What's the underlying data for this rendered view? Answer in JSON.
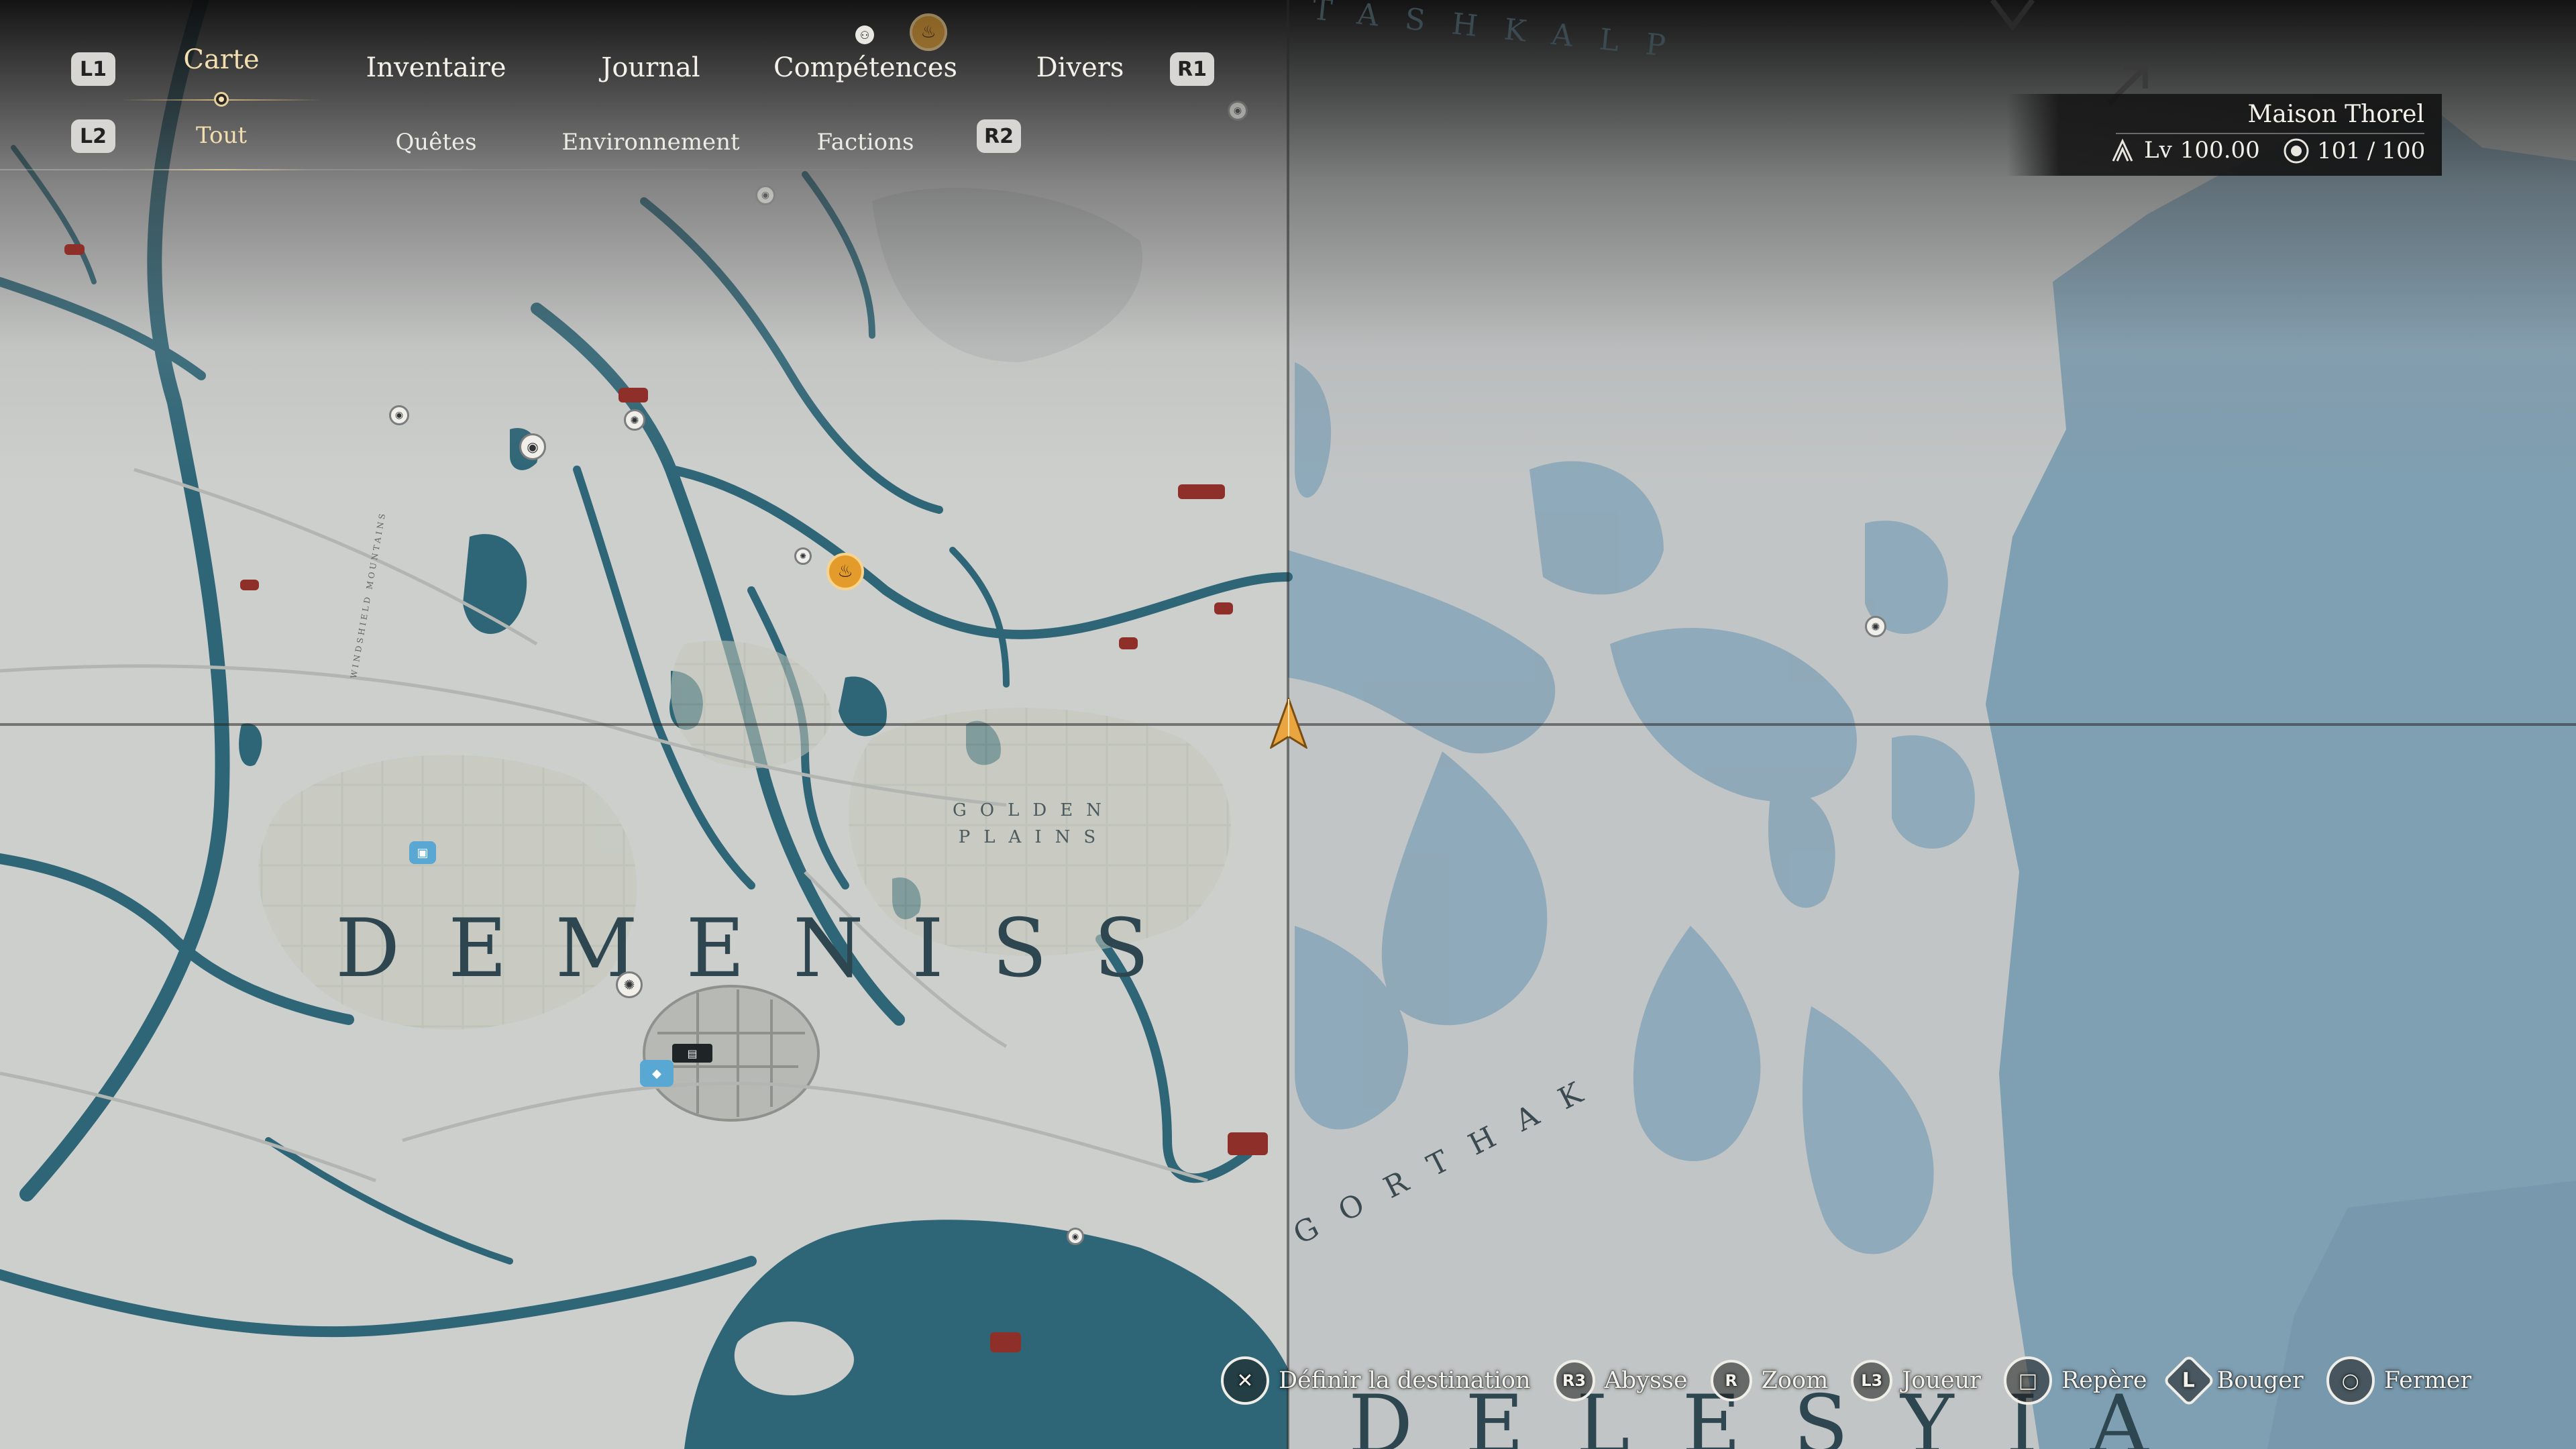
{
  "nav": {
    "row1": [
      {
        "key": "l1",
        "label": "L1"
      },
      {
        "key": "carte",
        "label": "Carte",
        "active": true
      },
      {
        "key": "inventaire",
        "label": "Inventaire"
      },
      {
        "key": "journal",
        "label": "Journal"
      },
      {
        "key": "competences",
        "label": "Compétences"
      },
      {
        "key": "divers",
        "label": "Divers"
      },
      {
        "key": "r1",
        "label": "R1"
      }
    ],
    "row2": [
      {
        "key": "l2",
        "label": "L2"
      },
      {
        "key": "tout",
        "label": "Tout",
        "active": true
      },
      {
        "key": "quetes",
        "label": "Quêtes"
      },
      {
        "key": "environnement",
        "label": "Environnement"
      },
      {
        "key": "factions",
        "label": "Factions"
      },
      {
        "key": "r2",
        "label": "R2"
      }
    ]
  },
  "info": {
    "name": "Maison Thorel",
    "level_label": "Lv",
    "level_value": "100.00",
    "capacity_current": "101",
    "capacity_sep": "/",
    "capacity_max": "100"
  },
  "map": {
    "regions": {
      "demeniss": "DEMENISS",
      "delesyia": "DELESYIA",
      "tashkalp": "TASHKALP",
      "gorthak": "GORTHAK",
      "golden_line1": "GOLDEN",
      "golden_line2": "PLAINS",
      "mountains": "WINDSHIELD MOUNTAINS"
    }
  },
  "legend": [
    {
      "glyph": "✕",
      "label": "Définir la destination"
    },
    {
      "glyph": "R3",
      "label": "Abysse"
    },
    {
      "glyph": "R",
      "label": "Zoom"
    },
    {
      "glyph": "L3",
      "label": "Joueur"
    },
    {
      "glyph": "□",
      "label": "Repère"
    },
    {
      "glyph": "L",
      "label": "Bouger"
    },
    {
      "glyph": "○",
      "label": "Fermer"
    }
  ],
  "colors": {
    "water": "#2e6677",
    "sea": "#7f9fb2",
    "land": "#cfd1cf",
    "accent_gold": "#e39b2c"
  }
}
